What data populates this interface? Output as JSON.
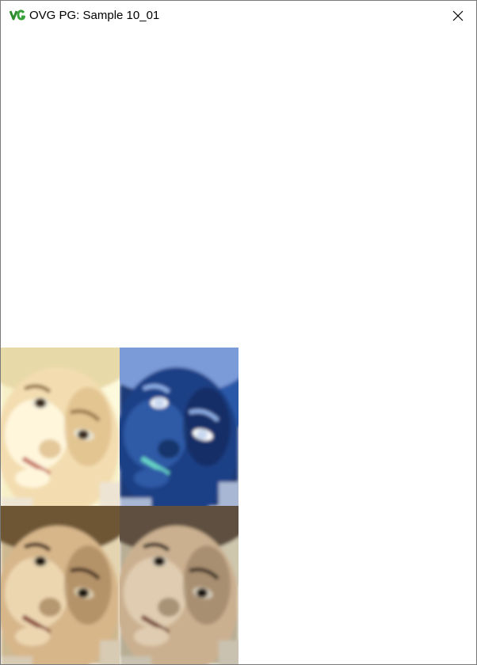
{
  "window": {
    "title": "OVG PG: Sample 10_01",
    "icon": "ovg-logo-icon",
    "close_icon": "close-icon"
  },
  "canvas": {
    "images": [
      {
        "name": "baby-photo-original",
        "filter": "original"
      },
      {
        "name": "baby-photo-inverted",
        "filter": "inverted"
      },
      {
        "name": "baby-photo-sepia",
        "filter": "sepia"
      },
      {
        "name": "baby-photo-desaturated",
        "filter": "desaturated"
      }
    ]
  },
  "colors": {
    "title_bar": "#ffffff",
    "border": "#7a7a7a",
    "logo_green": "#2e8b2e",
    "logo_green_dark": "#1f5f1f"
  }
}
